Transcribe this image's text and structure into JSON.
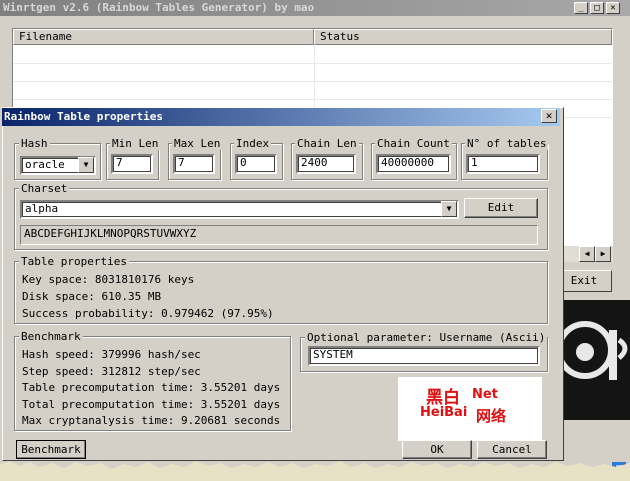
{
  "main_window": {
    "title": "Winrtgen v2.6 (Rainbow Tables Generator) by mao",
    "columns": [
      "Filename",
      "Status"
    ],
    "exit_label": "Exit"
  },
  "dialog": {
    "title": "Rainbow Table properties",
    "close_label": "✕",
    "params": {
      "hash": {
        "label": "Hash",
        "value": "oracle"
      },
      "min_len": {
        "label": "Min Len",
        "value": "7"
      },
      "max_len": {
        "label": "Max Len",
        "value": "7"
      },
      "index": {
        "label": "Index",
        "value": "0"
      },
      "chain_len": {
        "label": "Chain Len",
        "value": "2400"
      },
      "chain_count": {
        "label": "Chain Count",
        "value": "40000000"
      },
      "num_tables": {
        "label": "N° of tables",
        "value": "1"
      }
    },
    "charset": {
      "label": "Charset",
      "value": "alpha",
      "chars": "ABCDEFGHIJKLMNOPQRSTUVWXYZ",
      "edit_label": "Edit"
    },
    "table_properties": {
      "label": "Table properties",
      "key_space": "Key space: 8031810176 keys",
      "disk_space": "Disk space: 610.35 MB",
      "success": "Success probability: 0.979462 (97.95%)"
    },
    "benchmark": {
      "label": "Benchmark",
      "hash_speed": "Hash speed: 379996 hash/sec",
      "step_speed": "Step speed: 312812 step/sec",
      "table_precomp": "Table precomputation time: 3.55201 days",
      "total_precomp": "Total precomputation time: 3.55201 days",
      "max_crypt": "Max cryptanalysis time: 9.20681 seconds",
      "button_label": "Benchmark"
    },
    "optional": {
      "label": "Optional parameter: Username (Ascii)",
      "value": "SYSTEM"
    },
    "ok_label": "OK",
    "cancel_label": "Cancel"
  },
  "watermark": {
    "line1": "黑白",
    "net": "Net",
    "brand": "HeiBai",
    "cn": "网络"
  }
}
